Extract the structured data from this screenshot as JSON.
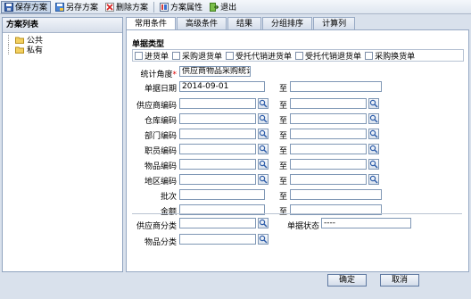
{
  "toolbar": {
    "save": "保存方案",
    "save_as": "另存方案",
    "delete": "删除方案",
    "properties": "方案属性",
    "exit": "退出"
  },
  "tree": {
    "header": "方案列表",
    "items": [
      "公共",
      "私有"
    ]
  },
  "tabs": [
    "常用条件",
    "高级条件",
    "结果",
    "分组排序",
    "计算列"
  ],
  "form": {
    "doc_type_title": "单据类型",
    "doc_types": [
      "进货单",
      "采购退货单",
      "受托代销进货单",
      "受托代销退货单",
      "采购换货单"
    ],
    "stat_angle_label": "统计角度",
    "stat_angle_value": "供应商物品采购统计",
    "date_label": "单据日期",
    "date_from": "2014-09-01",
    "to": "至",
    "range_rows": [
      "供应商编码",
      "仓库编码",
      "部门编码",
      "职员编码",
      "物品编码",
      "地区编码",
      "批次",
      "金额"
    ],
    "supplier_class_label": "供应商分类",
    "item_class_label": "物品分类",
    "doc_status_label": "单据状态",
    "doc_status_value": "----"
  },
  "buttons": {
    "ok": "确定",
    "cancel": "取消"
  }
}
